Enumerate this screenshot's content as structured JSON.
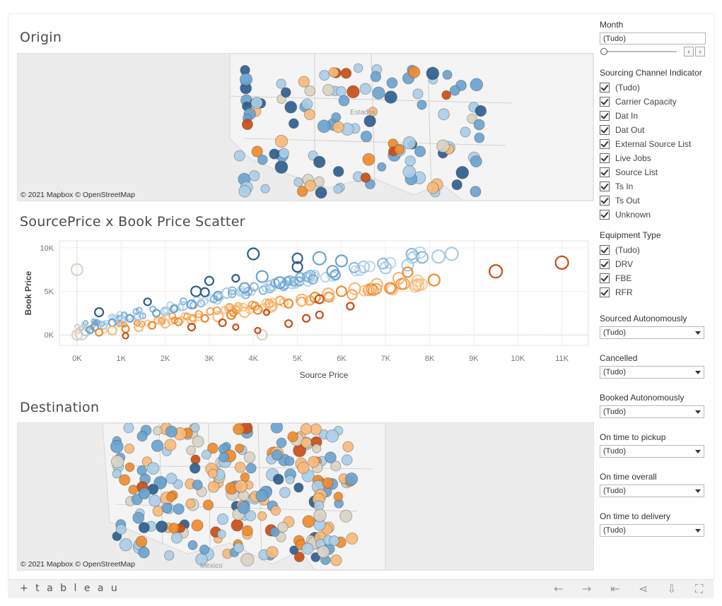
{
  "titles": {
    "origin": "Origin",
    "scatter": "SourcePrice x Book Price Scatter",
    "destination": "Destination"
  },
  "maps": {
    "attribution": "© 2021 Mapbox  © OpenStreetMap",
    "origin_label": "Estados",
    "dest_label": "Mexico"
  },
  "colors": {
    "dark_blue": "#2e5d8e",
    "mid_blue": "#6aa3cf",
    "light_blue": "#a9cde6",
    "beige": "#d9d3c4",
    "light_orange": "#f7b978",
    "mid_orange": "#f08a2c",
    "dark_orange": "#c94d12"
  },
  "chart_data": {
    "type": "scatter",
    "title": "SourcePrice x Book Price Scatter",
    "xlabel": "Source Price",
    "ylabel": "Book Price",
    "xlim": [
      -400,
      11600
    ],
    "ylim": [
      -1200,
      10800
    ],
    "x_ticks": [
      "0K",
      "1K",
      "2K",
      "3K",
      "4K",
      "5K",
      "6K",
      "7K",
      "8K",
      "9K",
      "10K",
      "11K"
    ],
    "y_ticks": [
      "0K",
      "5K",
      "10K"
    ],
    "grid": true,
    "points": [
      {
        "x": 0,
        "y": 0,
        "c": "beige",
        "r": 7
      },
      {
        "x": 0,
        "y": 7500,
        "c": "beige",
        "r": 8
      },
      {
        "x": 4200,
        "y": 0,
        "c": "beige",
        "r": 7
      },
      {
        "x": 100,
        "y": 200,
        "c": "beige",
        "r": 9
      },
      {
        "x": 200,
        "y": 400,
        "c": "light_blue",
        "r": 6
      },
      {
        "x": 300,
        "y": 600,
        "c": "mid_blue",
        "r": 5
      },
      {
        "x": 500,
        "y": 2600,
        "c": "dark_blue",
        "r": 6
      },
      {
        "x": 400,
        "y": 900,
        "c": "mid_blue",
        "r": 5
      },
      {
        "x": 600,
        "y": 1100,
        "c": "light_blue",
        "r": 5
      },
      {
        "x": 800,
        "y": 1400,
        "c": "mid_blue",
        "r": 5
      },
      {
        "x": 1000,
        "y": 1600,
        "c": "light_blue",
        "r": 6
      },
      {
        "x": 1200,
        "y": 1900,
        "c": "mid_blue",
        "r": 5
      },
      {
        "x": 1400,
        "y": 2200,
        "c": "light_blue",
        "r": 6
      },
      {
        "x": 1600,
        "y": 3800,
        "c": "dark_blue",
        "r": 5
      },
      {
        "x": 1800,
        "y": 2500,
        "c": "mid_blue",
        "r": 5
      },
      {
        "x": 2000,
        "y": 2700,
        "c": "light_blue",
        "r": 6
      },
      {
        "x": 2200,
        "y": 3000,
        "c": "mid_blue",
        "r": 5
      },
      {
        "x": 2400,
        "y": 3300,
        "c": "light_blue",
        "r": 6
      },
      {
        "x": 2600,
        "y": 3500,
        "c": "mid_blue",
        "r": 6
      },
      {
        "x": 2700,
        "y": 5000,
        "c": "dark_blue",
        "r": 7
      },
      {
        "x": 2900,
        "y": 4900,
        "c": "dark_blue",
        "r": 6
      },
      {
        "x": 3000,
        "y": 6200,
        "c": "dark_blue",
        "r": 6
      },
      {
        "x": 3200,
        "y": 4500,
        "c": "mid_blue",
        "r": 6
      },
      {
        "x": 3400,
        "y": 4800,
        "c": "light_blue",
        "r": 7
      },
      {
        "x": 3600,
        "y": 6500,
        "c": "dark_blue",
        "r": 5
      },
      {
        "x": 3800,
        "y": 5400,
        "c": "mid_blue",
        "r": 7
      },
      {
        "x": 4000,
        "y": 9300,
        "c": "dark_blue",
        "r": 8
      },
      {
        "x": 4200,
        "y": 6700,
        "c": "mid_blue",
        "r": 8
      },
      {
        "x": 4400,
        "y": 5700,
        "c": "light_blue",
        "r": 7
      },
      {
        "x": 4600,
        "y": 6000,
        "c": "mid_blue",
        "r": 8
      },
      {
        "x": 5000,
        "y": 8800,
        "c": "dark_blue",
        "r": 7
      },
      {
        "x": 5000,
        "y": 7800,
        "c": "dark_blue",
        "r": 7
      },
      {
        "x": 5500,
        "y": 8800,
        "c": "mid_blue",
        "r": 9
      },
      {
        "x": 5800,
        "y": 7300,
        "c": "mid_blue",
        "r": 8
      },
      {
        "x": 6000,
        "y": 8500,
        "c": "mid_blue",
        "r": 8
      },
      {
        "x": 6500,
        "y": 7800,
        "c": "light_blue",
        "r": 8
      },
      {
        "x": 7000,
        "y": 7700,
        "c": "light_blue",
        "r": 8
      },
      {
        "x": 7500,
        "y": 8000,
        "c": "light_blue",
        "r": 8
      },
      {
        "x": 8200,
        "y": 9000,
        "c": "light_blue",
        "r": 9
      },
      {
        "x": 8500,
        "y": 9300,
        "c": "light_blue",
        "r": 9
      },
      {
        "x": 500,
        "y": 300,
        "c": "mid_orange",
        "r": 5
      },
      {
        "x": 800,
        "y": 500,
        "c": "light_orange",
        "r": 6
      },
      {
        "x": 1100,
        "y": 700,
        "c": "mid_orange",
        "r": 5
      },
      {
        "x": 1400,
        "y": 900,
        "c": "light_orange",
        "r": 6
      },
      {
        "x": 1700,
        "y": 1100,
        "c": "mid_orange",
        "r": 5
      },
      {
        "x": 2000,
        "y": 1300,
        "c": "light_orange",
        "r": 6
      },
      {
        "x": 2300,
        "y": 1500,
        "c": "mid_orange",
        "r": 5
      },
      {
        "x": 2600,
        "y": 1700,
        "c": "light_orange",
        "r": 6
      },
      {
        "x": 2900,
        "y": 1900,
        "c": "mid_orange",
        "r": 5
      },
      {
        "x": 3200,
        "y": 2100,
        "c": "light_orange",
        "r": 7
      },
      {
        "x": 3500,
        "y": 2300,
        "c": "mid_orange",
        "r": 6
      },
      {
        "x": 3800,
        "y": 2600,
        "c": "light_orange",
        "r": 7
      },
      {
        "x": 4100,
        "y": 2900,
        "c": "mid_orange",
        "r": 6
      },
      {
        "x": 4400,
        "y": 3200,
        "c": "light_orange",
        "r": 7
      },
      {
        "x": 4800,
        "y": 3600,
        "c": "mid_orange",
        "r": 6
      },
      {
        "x": 5100,
        "y": 4000,
        "c": "light_orange",
        "r": 8
      },
      {
        "x": 5400,
        "y": 4300,
        "c": "mid_orange",
        "r": 7
      },
      {
        "x": 5700,
        "y": 4700,
        "c": "light_orange",
        "r": 8
      },
      {
        "x": 6000,
        "y": 5000,
        "c": "mid_orange",
        "r": 7
      },
      {
        "x": 6300,
        "y": 5300,
        "c": "light_orange",
        "r": 8
      },
      {
        "x": 6800,
        "y": 5800,
        "c": "light_orange",
        "r": 8
      },
      {
        "x": 7300,
        "y": 6500,
        "c": "light_orange",
        "r": 8
      },
      {
        "x": 7500,
        "y": 7200,
        "c": "mid_orange",
        "r": 7
      },
      {
        "x": 8100,
        "y": 6300,
        "c": "mid_orange",
        "r": 8
      },
      {
        "x": 9500,
        "y": 7300,
        "c": "dark_orange",
        "r": 9
      },
      {
        "x": 11000,
        "y": 8300,
        "c": "dark_orange",
        "r": 9
      },
      {
        "x": 1100,
        "y": -100,
        "c": "dark_orange",
        "r": 4
      },
      {
        "x": 2600,
        "y": 900,
        "c": "dark_orange",
        "r": 5
      },
      {
        "x": 3300,
        "y": 1400,
        "c": "dark_orange",
        "r": 5
      },
      {
        "x": 4300,
        "y": 2600,
        "c": "dark_orange",
        "r": 4
      },
      {
        "x": 4100,
        "y": 500,
        "c": "dark_orange",
        "r": 4
      },
      {
        "x": 5200,
        "y": 1900,
        "c": "dark_orange",
        "r": 5
      },
      {
        "x": 5500,
        "y": 2300,
        "c": "dark_orange",
        "r": 5
      },
      {
        "x": 5500,
        "y": 4100,
        "c": "dark_orange",
        "r": 6
      },
      {
        "x": 6200,
        "y": 3300,
        "c": "dark_orange",
        "r": 5
      },
      {
        "x": 4800,
        "y": 1300,
        "c": "dark_orange",
        "r": 5
      },
      {
        "x": 3600,
        "y": 900,
        "c": "dark_orange",
        "r": 4
      }
    ]
  },
  "filters": {
    "month_label": "Month",
    "month_value": "(Tudo)",
    "sourcing_label": "Sourcing Channel Indicator",
    "sourcing_items": [
      "(Tudo)",
      "Carrier Capacity",
      "Dat In",
      "Dat Out",
      "External Source List",
      "Live Jobs",
      "Source List",
      "Ts In",
      "Ts Out",
      "Unknown"
    ],
    "equipment_label": "Equipment Type",
    "equipment_items": [
      "(Tudo)",
      "DRV",
      "FBE",
      "RFR"
    ],
    "dropdowns": [
      {
        "label": "Sourced Autonomously",
        "value": "(Tudo)"
      },
      {
        "label": "Cancelled",
        "value": "(Tudo)"
      },
      {
        "label": "Booked Autonomously",
        "value": "(Tudo)"
      },
      {
        "label": "On time to pickup",
        "value": "(Tudo)"
      },
      {
        "label": "On time overall",
        "value": "(Tudo)"
      },
      {
        "label": "On time to delivery",
        "value": "(Tudo)"
      }
    ]
  },
  "footer": {
    "logo": "+ t a b l e a u",
    "icons": [
      "undo-icon",
      "redo-icon",
      "revert-icon",
      "share-icon",
      "download-icon",
      "fullscreen-icon"
    ]
  }
}
